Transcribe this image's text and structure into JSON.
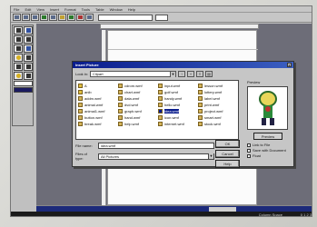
{
  "menubar": {
    "items": [
      "File",
      "Edit",
      "View",
      "Insert",
      "Format",
      "Tools",
      "Table",
      "Window",
      "Help"
    ]
  },
  "dialog": {
    "title": "Insert Picture",
    "close_label": "x",
    "look_in_label": "Look in:",
    "look_in_value": "Clipart",
    "files": [
      [
        "A",
        "anib",
        "addm.wmf",
        "animal.wmf",
        "animal1.wmf",
        "button.wmf",
        "break.wmf"
      ],
      [
        "cdrom.wmf",
        "chart.wmf",
        "data.wmf",
        "dvd.wmf",
        "graph.wmf",
        "hand.wmf",
        "help.wmf"
      ],
      [
        "input.wmf",
        "golf.wmf",
        "handy.wmf",
        "hello.wmf",
        "idea.wmf",
        "icon.wmf",
        "internet.wmf"
      ],
      [
        "lesson.wmf",
        "lottery.wmf",
        "label.wmf",
        "print.wmf",
        "project.wmf",
        "smart.wmf",
        "stock.wmf"
      ]
    ],
    "selected_file": "idea.wmf",
    "file_name_label": "File name:",
    "file_name_value": "idea.wmf",
    "file_type_label": "Files of type:",
    "file_type_value": "All Pictures",
    "ok_label": "OK",
    "cancel_label": "Cancel",
    "help_label": "Help",
    "preview_label": "Preview",
    "preview_button_label": "Preview",
    "options": [
      "Link to File",
      "Save with Document",
      "Float"
    ]
  },
  "statusbar": {
    "text": "Column Space",
    "text2": "0 1 2 3"
  },
  "colors": {
    "title_bar": "#0a1c8c",
    "workspace": "#6d6d78",
    "status_bar": "#1a1a1a"
  }
}
